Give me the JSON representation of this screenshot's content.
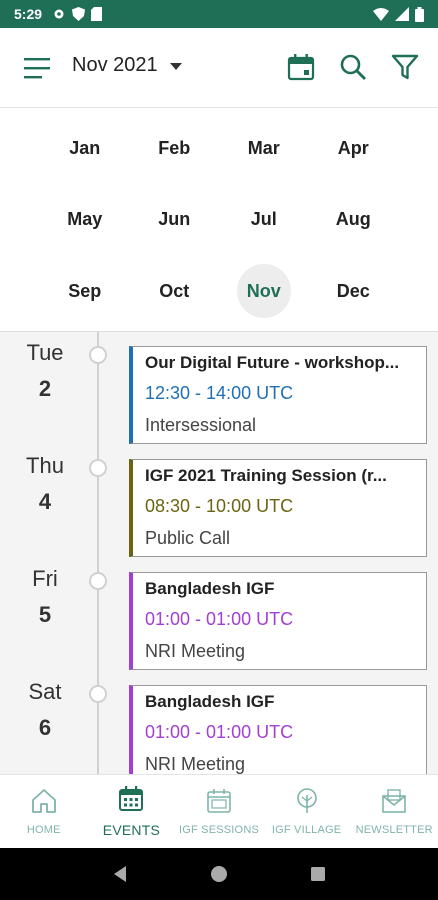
{
  "status_bar": {
    "time": "5:29"
  },
  "header": {
    "month_label": "Nov 2021"
  },
  "months": [
    {
      "label": "Jan",
      "selected": false
    },
    {
      "label": "Feb",
      "selected": false
    },
    {
      "label": "Mar",
      "selected": false
    },
    {
      "label": "Apr",
      "selected": false
    },
    {
      "label": "May",
      "selected": false
    },
    {
      "label": "Jun",
      "selected": false
    },
    {
      "label": "Jul",
      "selected": false
    },
    {
      "label": "Aug",
      "selected": false
    },
    {
      "label": "Sep",
      "selected": false
    },
    {
      "label": "Oct",
      "selected": false
    },
    {
      "label": "Nov",
      "selected": true
    },
    {
      "label": "Dec",
      "selected": false
    }
  ],
  "events": [
    {
      "day_name": "Tue",
      "day_num": "2",
      "title": "Our Digital Future - workshop...",
      "time": "12:30 - 14:00 UTC",
      "category": "Intersessional",
      "color": "#1f6fb5"
    },
    {
      "day_name": "Thu",
      "day_num": "4",
      "title": "IGF 2021 Training Session (r...",
      "time": "08:30 - 10:00 UTC",
      "category": "Public Call",
      "color": "#6b6412"
    },
    {
      "day_name": "Fri",
      "day_num": "5",
      "title": "Bangladesh IGF",
      "time": "01:00 - 01:00 UTC",
      "category": "NRI Meeting",
      "color": "#a23fd6"
    },
    {
      "day_name": "Sat",
      "day_num": "6",
      "title": "Bangladesh IGF",
      "time": "01:00 - 01:00 UTC",
      "category": "NRI Meeting",
      "color": "#a23fd6"
    }
  ],
  "bottom_nav": [
    {
      "label": "HOME",
      "icon": "home-icon",
      "active": false
    },
    {
      "label": "EVENTS",
      "icon": "calendar-icon",
      "active": true
    },
    {
      "label": "IGF SESSIONS",
      "icon": "igf-sessions-icon",
      "active": false
    },
    {
      "label": "IGF VILLAGE",
      "icon": "tree-icon",
      "active": false
    },
    {
      "label": "NEWSLETTER",
      "icon": "newsletter-icon",
      "active": false
    }
  ],
  "colors": {
    "accent": "#1f6f57",
    "status_bar": "#1f6f57"
  }
}
